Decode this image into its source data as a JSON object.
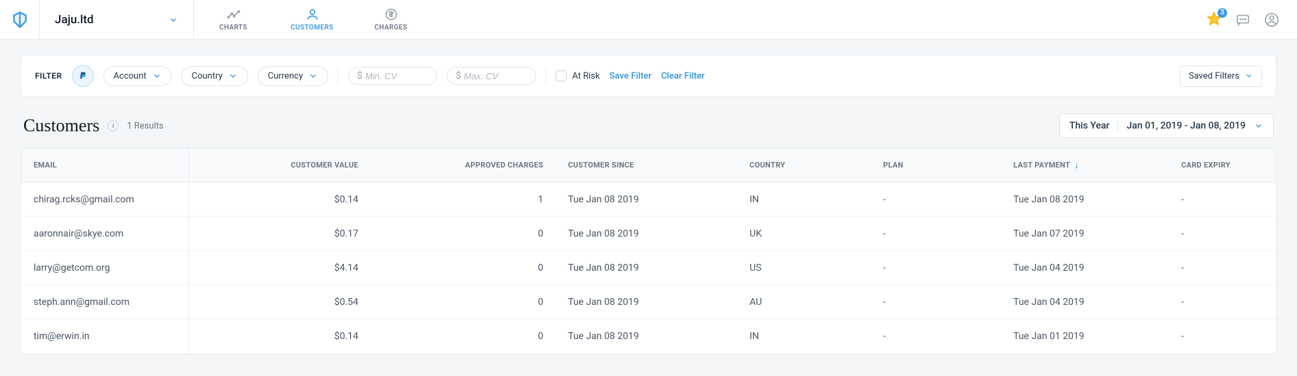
{
  "header": {
    "org_name": "Jaju.ltd",
    "notification_count": "3",
    "nav": {
      "charts": "CHARTS",
      "customers": "CUSTOMERS",
      "charges": "CHARGES"
    }
  },
  "filters": {
    "label": "FILTER",
    "account": "Account",
    "country": "Country",
    "currency": "Currency",
    "min_cv_placeholder": "Min. CV",
    "max_cv_placeholder": "Max. CV",
    "at_risk": "At Risk",
    "save": "Save Filter",
    "clear": "Clear Filter",
    "saved": "Saved Filters"
  },
  "heading": {
    "title": "Customers",
    "results": "1 Results",
    "period": "This Year",
    "date_range": "Jan 01, 2019 - Jan 08, 2019"
  },
  "table": {
    "columns": {
      "email": "EMAIL",
      "cv": "CUSTOMER VALUE",
      "ac": "APPROVED CHARGES",
      "since": "CUSTOMER SINCE",
      "country": "COUNTRY",
      "plan": "PLAN",
      "last_payment": "LAST PAYMENT",
      "card_expiry": "CARD EXPIRY"
    },
    "rows": [
      {
        "email": "chirag.rcks@gmail.com",
        "cv": "$0.14",
        "ac": "1",
        "since": "Tue Jan 08 2019",
        "country": "IN",
        "plan": "-",
        "last_payment": "Tue Jan 08 2019",
        "expiry": "-"
      },
      {
        "email": "aaronnair@skye.com",
        "cv": "$0.17",
        "ac": "0",
        "since": "Tue Jan 08 2019",
        "country": "UK",
        "plan": "-",
        "last_payment": "Tue Jan 07 2019",
        "expiry": "-"
      },
      {
        "email": "larry@getcom.org",
        "cv": "$4.14",
        "ac": "0",
        "since": "Tue Jan 08 2019",
        "country": "US",
        "plan": "-",
        "last_payment": "Tue Jan 04 2019",
        "expiry": "-"
      },
      {
        "email": "steph.ann@gmail.com",
        "cv": "$0.54",
        "ac": "0",
        "since": "Tue Jan 08 2019",
        "country": "AU",
        "plan": "-",
        "last_payment": "Tue Jan 04 2019",
        "expiry": "-"
      },
      {
        "email": "tim@erwin.in",
        "cv": "$0.14",
        "ac": "0",
        "since": "Tue Jan 08 2019",
        "country": "IN",
        "plan": "-",
        "last_payment": "Tue Jan 01 2019",
        "expiry": "-"
      }
    ]
  }
}
